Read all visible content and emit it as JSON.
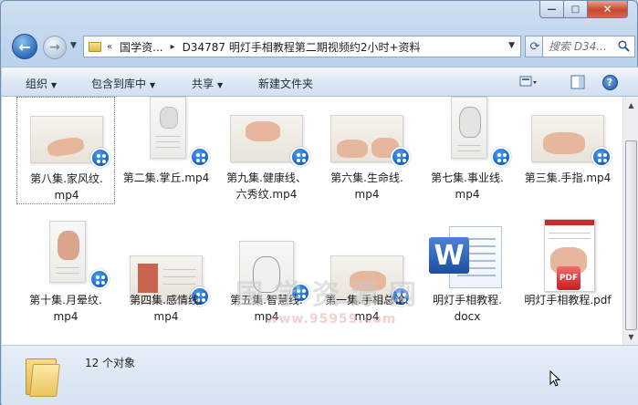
{
  "window": {
    "caption_buttons": {
      "minimize": "—",
      "maximize": "□",
      "close": "✕"
    }
  },
  "nav": {
    "address_segments": [
      "«",
      "国学资...",
      "▸",
      "D34787 明灯手相教程第二期视频约2小时+资料"
    ],
    "search_placeholder": "搜索 D34..."
  },
  "toolbar": {
    "organize": "组织",
    "include_in_library": "包含到库中",
    "share": "共享",
    "new_folder": "新建文件夹"
  },
  "files": [
    {
      "name": "第八集.家风纹.",
      "ext": "mp4",
      "type": "video"
    },
    {
      "name": "第二集.掌丘.mp4",
      "ext": "",
      "type": "video-tall"
    },
    {
      "name": "第九集.健康线、",
      "ext": "六秀纹.mp4",
      "type": "video"
    },
    {
      "name": "第六集.生命线.",
      "ext": "mp4",
      "type": "video"
    },
    {
      "name": "第七集.事业线.",
      "ext": "mp4",
      "type": "video-tall"
    },
    {
      "name": "第三集.手指.mp4",
      "ext": "",
      "type": "video"
    },
    {
      "name": "第十集.月晕纹.",
      "ext": "mp4",
      "type": "video-tall"
    },
    {
      "name": "第四集.感情线.",
      "ext": "mp4",
      "type": "video"
    },
    {
      "name": "第五集.智慧线.",
      "ext": "mp4",
      "type": "video-tall"
    },
    {
      "name": "第一集.手相总论.",
      "ext": "mp4",
      "type": "video"
    },
    {
      "name": "明灯手相教程.",
      "ext": "docx",
      "type": "docx"
    },
    {
      "name": "明灯手相教程.pdf",
      "ext": "",
      "type": "pdf"
    }
  ],
  "watermark": {
    "title": "国学资源网",
    "url": "www.95959.com"
  },
  "status": {
    "count_text": "12 个对象"
  },
  "colors": {
    "accent": "#1560c7",
    "toolbar_bg": "#dde8f4",
    "content_bg": "#ffffff"
  }
}
